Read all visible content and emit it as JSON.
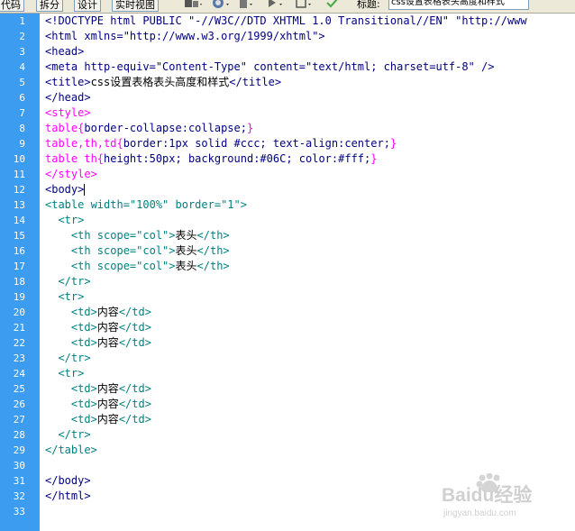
{
  "toolbar": {
    "code_label": "代码",
    "split_label": "拆分",
    "design_label": "设计",
    "live_view_label": "实时视图",
    "title_label": "标题:",
    "title_value": "css设置表格表头高度和样式"
  },
  "editor": {
    "lines": [
      {
        "n": "1",
        "segs": [
          {
            "t": "<!DOCTYPE html PUBLIC \"-//W3C//DTD XHTML 1.0 Transitional//EN\" \"http://www",
            "c": "tag"
          }
        ]
      },
      {
        "n": "2",
        "segs": [
          {
            "t": "<html xmlns=\"http://www.w3.org/1999/xhtml\">",
            "c": "tag"
          }
        ]
      },
      {
        "n": "3",
        "segs": [
          {
            "t": "<head>",
            "c": "tag"
          }
        ]
      },
      {
        "n": "4",
        "segs": [
          {
            "t": "<meta http-equiv=\"Content-Type\" content=\"text/html; charset=utf-8\" />",
            "c": "tag"
          }
        ]
      },
      {
        "n": "5",
        "segs": [
          {
            "t": "<title>",
            "c": "tag"
          },
          {
            "t": "css设置表格表头高度和样式",
            "c": "blk"
          },
          {
            "t": "</title>",
            "c": "tag"
          }
        ]
      },
      {
        "n": "6",
        "segs": [
          {
            "t": "</head>",
            "c": "tag"
          }
        ]
      },
      {
        "n": "7",
        "segs": [
          {
            "t": "<style>",
            "c": "sel"
          }
        ]
      },
      {
        "n": "8",
        "segs": [
          {
            "t": "table",
            "c": "sel"
          },
          {
            "t": "{",
            "c": "pun"
          },
          {
            "t": "border-collapse:collapse;",
            "c": "tag"
          },
          {
            "t": "}",
            "c": "pun"
          }
        ]
      },
      {
        "n": "9",
        "segs": [
          {
            "t": "table,th,td",
            "c": "sel"
          },
          {
            "t": "{",
            "c": "pun"
          },
          {
            "t": "border:1px solid #ccc; text-align:center;",
            "c": "tag"
          },
          {
            "t": "}",
            "c": "pun"
          }
        ]
      },
      {
        "n": "10",
        "segs": [
          {
            "t": "table th",
            "c": "sel"
          },
          {
            "t": "{",
            "c": "pun"
          },
          {
            "t": "height:50px; background:#06C; color:#fff;",
            "c": "tag"
          },
          {
            "t": "}",
            "c": "pun"
          }
        ]
      },
      {
        "n": "11",
        "segs": [
          {
            "t": "</style>",
            "c": "sel"
          }
        ]
      },
      {
        "n": "12",
        "segs": [
          {
            "t": "<body>",
            "c": "tag"
          }
        ],
        "caret": true
      },
      {
        "n": "13",
        "segs": [
          {
            "t": "<table width=\"100%\" border=\"1\">",
            "c": "at"
          }
        ]
      },
      {
        "n": "14",
        "segs": [
          {
            "t": "  <tr>",
            "c": "at"
          }
        ]
      },
      {
        "n": "15",
        "segs": [
          {
            "t": "    <th scope=\"col\">",
            "c": "at"
          },
          {
            "t": "表头",
            "c": "blk"
          },
          {
            "t": "</th>",
            "c": "at"
          }
        ]
      },
      {
        "n": "16",
        "segs": [
          {
            "t": "    <th scope=\"col\">",
            "c": "at"
          },
          {
            "t": "表头",
            "c": "blk"
          },
          {
            "t": "</th>",
            "c": "at"
          }
        ]
      },
      {
        "n": "17",
        "segs": [
          {
            "t": "    <th scope=\"col\">",
            "c": "at"
          },
          {
            "t": "表头",
            "c": "blk"
          },
          {
            "t": "</th>",
            "c": "at"
          }
        ]
      },
      {
        "n": "18",
        "segs": [
          {
            "t": "  </tr>",
            "c": "at"
          }
        ]
      },
      {
        "n": "19",
        "segs": [
          {
            "t": "  <tr>",
            "c": "at"
          }
        ]
      },
      {
        "n": "20",
        "segs": [
          {
            "t": "    <td>",
            "c": "at"
          },
          {
            "t": "内容",
            "c": "blk"
          },
          {
            "t": "</td>",
            "c": "at"
          }
        ]
      },
      {
        "n": "21",
        "segs": [
          {
            "t": "    <td>",
            "c": "at"
          },
          {
            "t": "内容",
            "c": "blk"
          },
          {
            "t": "</td>",
            "c": "at"
          }
        ]
      },
      {
        "n": "22",
        "segs": [
          {
            "t": "    <td>",
            "c": "at"
          },
          {
            "t": "内容",
            "c": "blk"
          },
          {
            "t": "</td>",
            "c": "at"
          }
        ]
      },
      {
        "n": "23",
        "segs": [
          {
            "t": "  </tr>",
            "c": "at"
          }
        ]
      },
      {
        "n": "24",
        "segs": [
          {
            "t": "  <tr>",
            "c": "at"
          }
        ]
      },
      {
        "n": "25",
        "segs": [
          {
            "t": "    <td>",
            "c": "at"
          },
          {
            "t": "内容",
            "c": "blk"
          },
          {
            "t": "</td>",
            "c": "at"
          }
        ]
      },
      {
        "n": "26",
        "segs": [
          {
            "t": "    <td>",
            "c": "at"
          },
          {
            "t": "内容",
            "c": "blk"
          },
          {
            "t": "</td>",
            "c": "at"
          }
        ]
      },
      {
        "n": "27",
        "segs": [
          {
            "t": "    <td>",
            "c": "at"
          },
          {
            "t": "内容",
            "c": "blk"
          },
          {
            "t": "</td>",
            "c": "at"
          }
        ]
      },
      {
        "n": "28",
        "segs": [
          {
            "t": "  </tr>",
            "c": "at"
          }
        ]
      },
      {
        "n": "29",
        "segs": [
          {
            "t": "</table>",
            "c": "at"
          }
        ]
      },
      {
        "n": "30",
        "segs": []
      },
      {
        "n": "31",
        "segs": [
          {
            "t": "</body>",
            "c": "tag"
          }
        ]
      },
      {
        "n": "32",
        "segs": [
          {
            "t": "</html>",
            "c": "tag"
          }
        ]
      },
      {
        "n": "33",
        "segs": []
      }
    ]
  },
  "watermark": {
    "brand": "Baidu经验",
    "url": "jingyan.baidu.com"
  },
  "colors": {
    "gutter": "#3b9cf0",
    "tag": "#000080",
    "attribute": "#008080",
    "style": "#ff00ff"
  }
}
